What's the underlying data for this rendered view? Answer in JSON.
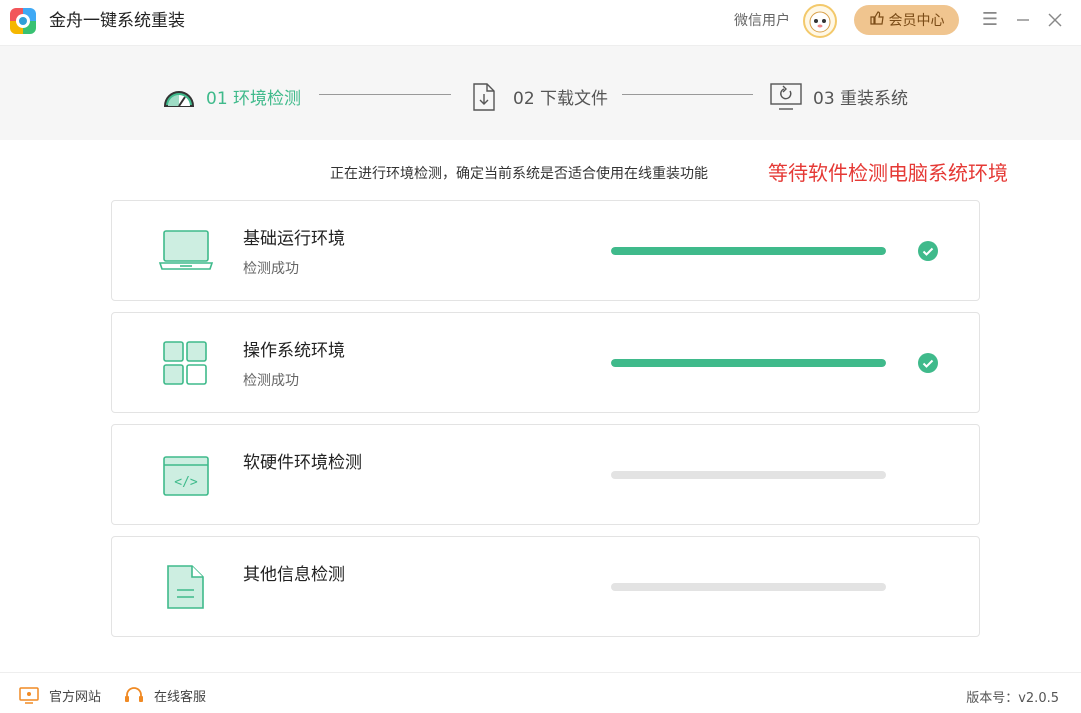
{
  "app": {
    "title": "金舟一键系统重装",
    "user_name": "微信用户",
    "vip_label": "会员中心",
    "icons": {
      "menu": "menu-icon",
      "minimize": "minimize-icon",
      "close": "close-icon"
    }
  },
  "steps": [
    {
      "label": "01 环境检测",
      "icon": "gauge-icon",
      "active": true
    },
    {
      "label": "02 下载文件",
      "icon": "download-file-icon",
      "active": false
    },
    {
      "label": "03 重装系统",
      "icon": "reinstall-monitor-icon",
      "active": false
    }
  ],
  "status": {
    "message": "正在进行环境检测，确定当前系统是否适合使用在线重装功能",
    "highlight": "等待软件检测电脑系统环境"
  },
  "checks": [
    {
      "title": "基础运行环境",
      "subtitle": "检测成功",
      "progress": 1.0,
      "done": true,
      "icon": "laptop-icon"
    },
    {
      "title": "操作系统环境",
      "subtitle": "检测成功",
      "progress": 1.0,
      "done": true,
      "icon": "windows-grid-icon"
    },
    {
      "title": "软硬件环境检测",
      "subtitle": "",
      "progress": 0.0,
      "done": false,
      "icon": "code-window-icon"
    },
    {
      "title": "其他信息检测",
      "subtitle": "",
      "progress": 0.0,
      "done": false,
      "icon": "document-icon"
    }
  ],
  "footer": {
    "website": "官方网站",
    "service": "在线客服",
    "version": "版本号：v2.0.5"
  },
  "colors": {
    "accent": "#3fba8b",
    "highlight": "#e53935",
    "vip": "#f0c58f"
  }
}
